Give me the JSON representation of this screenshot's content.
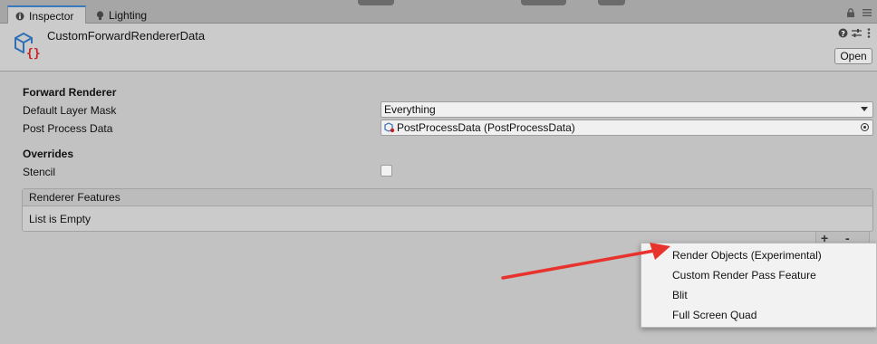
{
  "tabs": [
    {
      "label": "Inspector",
      "icon": "info-icon",
      "active": true
    },
    {
      "label": "Lighting",
      "icon": "lightbulb-icon",
      "active": false
    }
  ],
  "header": {
    "title": "CustomForwardRendererData",
    "open_label": "Open",
    "icons": [
      "help-icon",
      "preset-icon",
      "more-icon"
    ]
  },
  "forward_renderer": {
    "section_title": "Forward Renderer",
    "layer_mask_label": "Default Layer Mask",
    "layer_mask_value": "Everything",
    "post_process_label": "Post Process Data",
    "post_process_value": "PostProcessData (PostProcessData)"
  },
  "overrides": {
    "section_title": "Overrides",
    "stencil_label": "Stencil",
    "stencil_checked": false
  },
  "renderer_features": {
    "header": "Renderer Features",
    "empty_text": "List is Empty",
    "add_label": "+",
    "remove_label": "-"
  },
  "popup_menu": {
    "items": [
      "Render Objects (Experimental)",
      "Custom Render Pass Feature",
      "Blit",
      "Full Screen Quad"
    ]
  },
  "annotation": {
    "arrow_color": "#e8322c"
  },
  "colors": {
    "tab_accent": "#3a79bb",
    "background": "#c2c2c2"
  }
}
